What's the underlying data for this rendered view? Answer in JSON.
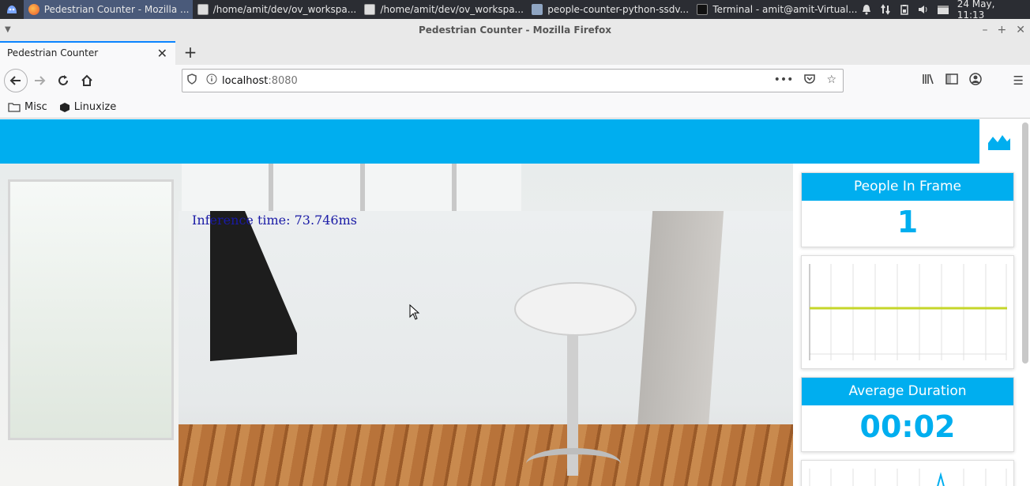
{
  "taskbar": {
    "tasks": [
      {
        "label": "Pedestrian Counter - Mozilla ...",
        "icon": "firefox-icon",
        "active": true
      },
      {
        "label": "/home/amit/dev/ov_workspa...",
        "icon": "text-editor-icon"
      },
      {
        "label": "/home/amit/dev/ov_workspa...",
        "icon": "text-editor-icon"
      },
      {
        "label": "people-counter-python-ssdv...",
        "icon": "folder-icon"
      },
      {
        "label": "Terminal - amit@amit-Virtual...",
        "icon": "terminal-icon"
      }
    ],
    "clock": "24 May, 11:13"
  },
  "window": {
    "title": "Pedestrian Counter - Mozilla Firefox"
  },
  "tabs": [
    {
      "label": "Pedestrian Counter"
    }
  ],
  "navbar": {
    "url_host": "localhost",
    "url_port": ":8080"
  },
  "bookmarks": [
    {
      "label": "Misc",
      "icon": "folder-icon"
    },
    {
      "label": "Linuxize",
      "icon": "linuxize-icon"
    }
  ],
  "app": {
    "accent": "#00aeef",
    "inference_text": "Inference time: 73.746ms",
    "people_in_frame": {
      "title": "People In Frame",
      "value": "1"
    },
    "average_duration": {
      "title": "Average Duration",
      "value": "00:02"
    }
  }
}
